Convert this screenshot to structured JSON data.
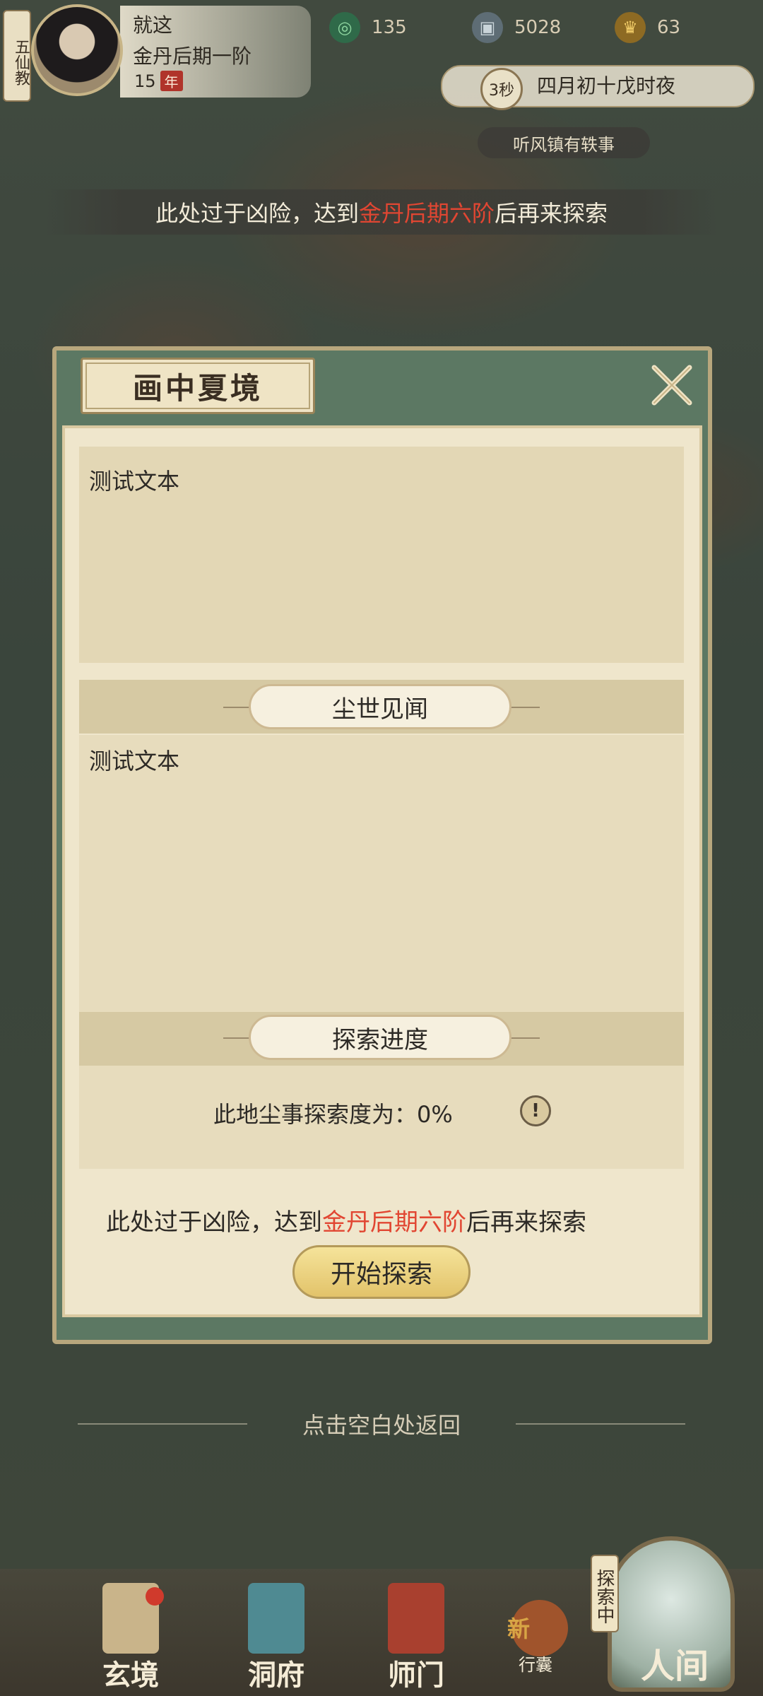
{
  "header": {
    "sect_tag": "五仙教",
    "player_name": "就这",
    "player_rank": "金丹后期一阶",
    "player_years": "15",
    "year_unit": "年",
    "resources": [
      {
        "name": "spirit-stone",
        "icon": "swirl-icon",
        "value": "135",
        "color": "#4fa06a"
      },
      {
        "name": "coins",
        "icon": "coin-icon",
        "value": "5028",
        "color": "#8a9aa3"
      },
      {
        "name": "ingots",
        "icon": "ingot-icon",
        "value": "63",
        "color": "#d6a63a"
      }
    ],
    "timer": "3秒",
    "date_text": "四月初十戊时夜",
    "news": "听风镇有轶事"
  },
  "warning_banner": {
    "prefix": "此处过于凶险，达到",
    "highlight": "金丹后期六阶",
    "suffix": "后再来探索"
  },
  "modal": {
    "title": "画中夏境",
    "close_label": "✕",
    "description": "测试文本",
    "section_news": {
      "title": "尘世见闻",
      "text": "测试文本"
    },
    "section_progress": {
      "title": "探索进度",
      "progress_label": "此地尘事探索度为：",
      "progress_value": "0%",
      "info_icon": "!"
    },
    "bottom_warning": {
      "prefix": "此处过于凶险，达到",
      "highlight": "金丹后期六阶",
      "suffix": "后再来探索"
    },
    "start_button": "开始探索"
  },
  "return_hint": "点击空白处返回",
  "bottom_nav": {
    "items": [
      {
        "label": "玄境",
        "color": "#c9b48a"
      },
      {
        "label": "洞府",
        "color": "#4f8a92"
      },
      {
        "label": "师门",
        "color": "#a9402f"
      }
    ],
    "bag_new": "新",
    "bag_label": "行囊",
    "exploring_tag": "探索中",
    "world_label": "人间"
  }
}
